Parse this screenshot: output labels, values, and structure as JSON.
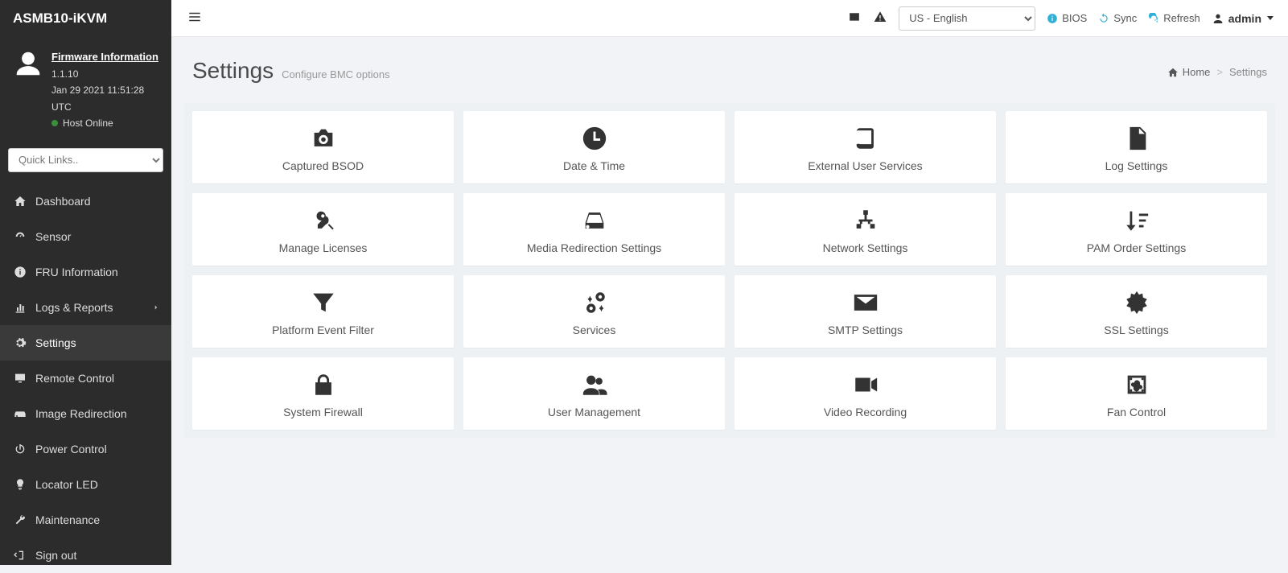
{
  "brand": "ASMB10-iKVM",
  "firmware": {
    "label": "Firmware Information",
    "version": "1.1.10",
    "time": "Jan 29 2021 11:51:28 UTC",
    "host_status": "Host Online"
  },
  "quicklinks_placeholder": "Quick Links..",
  "nav": [
    {
      "label": "Dashboard"
    },
    {
      "label": "Sensor"
    },
    {
      "label": "FRU Information"
    },
    {
      "label": "Logs & Reports",
      "chevron": true
    },
    {
      "label": "Settings",
      "active": true
    },
    {
      "label": "Remote Control"
    },
    {
      "label": "Image Redirection"
    },
    {
      "label": "Power Control"
    },
    {
      "label": "Locator LED"
    },
    {
      "label": "Maintenance"
    },
    {
      "label": "Sign out"
    }
  ],
  "topbar": {
    "language_selected": "US - English",
    "bios": "BIOS",
    "sync": "Sync",
    "refresh": "Refresh",
    "user": "admin"
  },
  "page": {
    "title": "Settings",
    "subtitle": "Configure BMC options"
  },
  "breadcrumb": {
    "home": "Home",
    "current": "Settings"
  },
  "cards": [
    {
      "label": "Captured BSOD"
    },
    {
      "label": "Date & Time"
    },
    {
      "label": "External User Services"
    },
    {
      "label": "Log Settings"
    },
    {
      "label": "Manage Licenses"
    },
    {
      "label": "Media Redirection Settings"
    },
    {
      "label": "Network Settings"
    },
    {
      "label": "PAM Order Settings"
    },
    {
      "label": "Platform Event Filter"
    },
    {
      "label": "Services"
    },
    {
      "label": "SMTP Settings"
    },
    {
      "label": "SSL Settings"
    },
    {
      "label": "System Firewall"
    },
    {
      "label": "User Management"
    },
    {
      "label": "Video Recording"
    },
    {
      "label": "Fan Control"
    }
  ]
}
